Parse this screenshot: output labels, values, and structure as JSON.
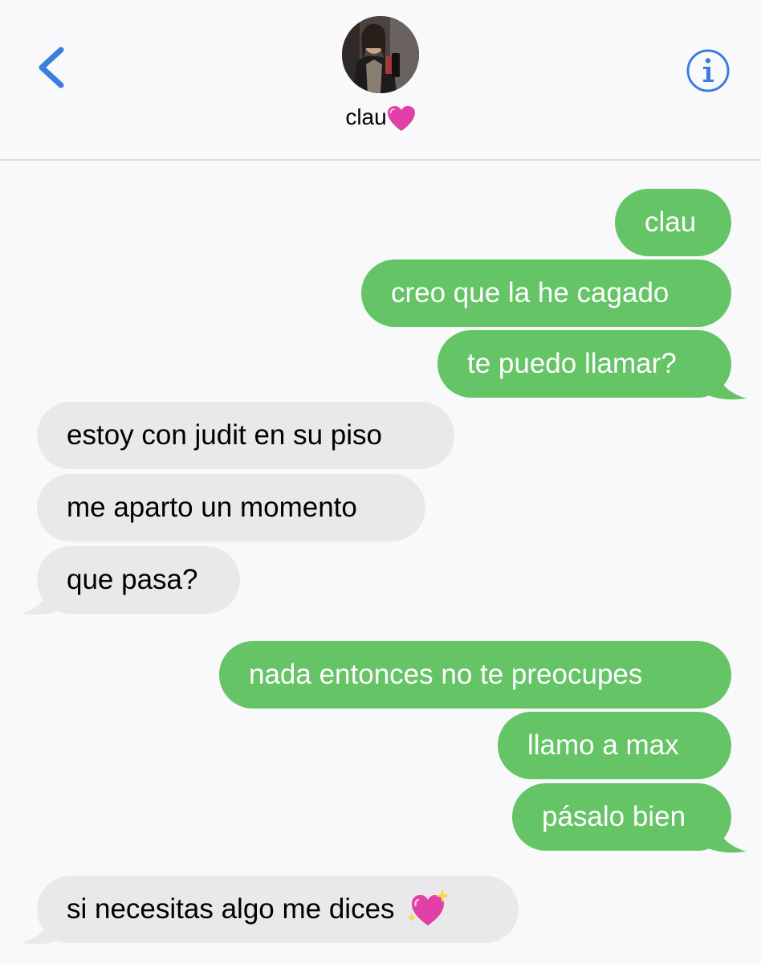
{
  "contact": {
    "name": "clau"
  },
  "colors": {
    "accent": "#3a7ee0",
    "outgoing": "#65c466",
    "incoming": "#e9e9eb",
    "heart": "#e040a8"
  },
  "icons": {
    "back": "chevron-left-icon",
    "info": "info-icon",
    "heart": "pink-heart-emoji",
    "sparkle": "sparkling-heart-emoji"
  },
  "messages": [
    {
      "direction": "outgoing",
      "text": "clau"
    },
    {
      "direction": "outgoing",
      "text": "creo que la he cagado"
    },
    {
      "direction": "outgoing",
      "text": "te puedo llamar?"
    },
    {
      "direction": "incoming",
      "text": "estoy con judit en su piso"
    },
    {
      "direction": "incoming",
      "text": "me aparto un momento"
    },
    {
      "direction": "incoming",
      "text": "que pasa?"
    },
    {
      "direction": "outgoing",
      "text": "nada entonces no te preocupes"
    },
    {
      "direction": "outgoing",
      "text": "llamo a max"
    },
    {
      "direction": "outgoing",
      "text": "pásalo bien"
    },
    {
      "direction": "incoming",
      "text": "si necesitas algo me dices"
    }
  ]
}
